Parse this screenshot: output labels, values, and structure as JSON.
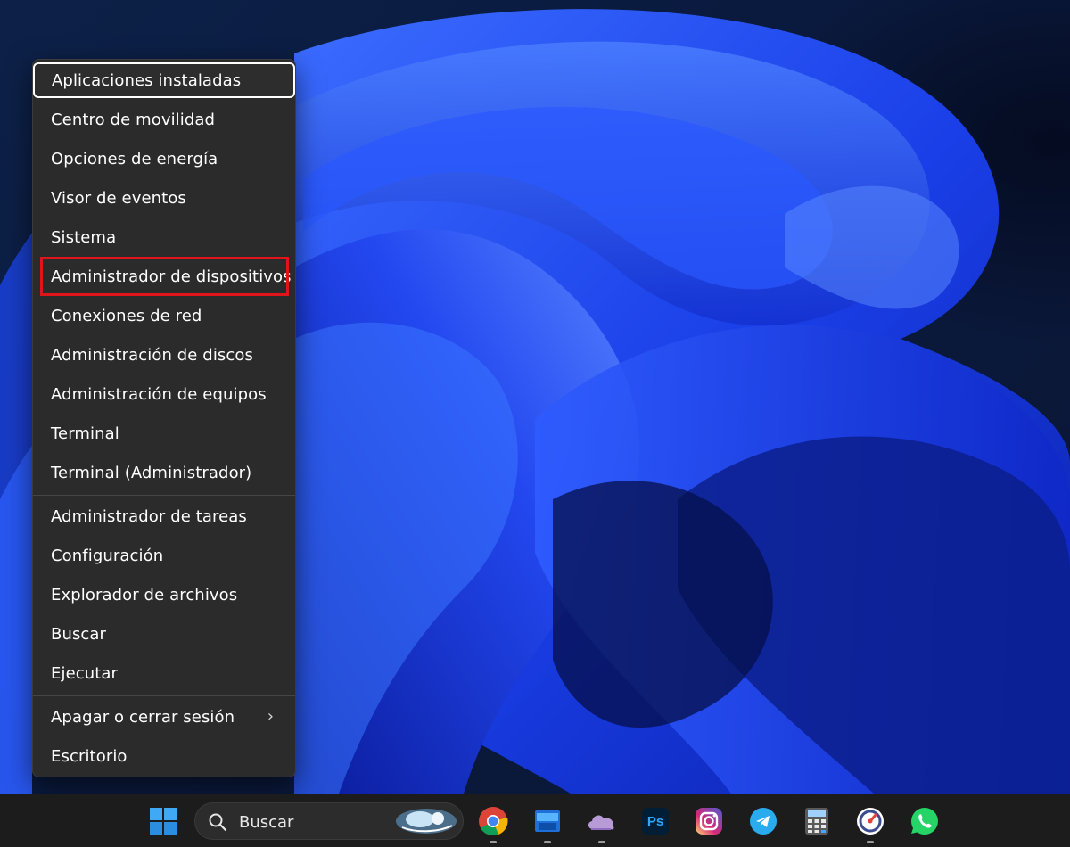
{
  "menu": {
    "groups": [
      [
        {
          "label": "Aplicaciones instaladas",
          "state": "focused"
        },
        {
          "label": "Centro de movilidad"
        },
        {
          "label": "Opciones de energía"
        },
        {
          "label": "Visor de eventos"
        },
        {
          "label": "Sistema"
        },
        {
          "label": "Administrador de dispositivos",
          "state": "highlighted"
        },
        {
          "label": "Conexiones de red"
        },
        {
          "label": "Administración de discos"
        },
        {
          "label": "Administración de equipos"
        },
        {
          "label": "Terminal"
        },
        {
          "label": "Terminal (Administrador)"
        }
      ],
      [
        {
          "label": "Administrador de tareas"
        },
        {
          "label": "Configuración"
        },
        {
          "label": "Explorador de archivos"
        },
        {
          "label": "Buscar"
        },
        {
          "label": "Ejecutar"
        }
      ],
      [
        {
          "label": "Apagar o cerrar sesión",
          "submenu": true
        },
        {
          "label": "Escritorio"
        }
      ]
    ],
    "submenu_glyph": "›",
    "highlight_color": "#e0151b"
  },
  "taskbar": {
    "search_placeholder": "Buscar",
    "apps": [
      {
        "name": "start-icon"
      },
      {
        "name": "search-icon"
      },
      {
        "name": "chrome-icon",
        "running": true
      },
      {
        "name": "file-explorer-icon",
        "running": true
      },
      {
        "name": "onedrive-icon",
        "running": true
      },
      {
        "name": "photoshop-icon",
        "label": "Ps"
      },
      {
        "name": "instagram-icon"
      },
      {
        "name": "telegram-icon"
      },
      {
        "name": "calculator-icon"
      },
      {
        "name": "speedtest-icon",
        "running": true
      },
      {
        "name": "whatsapp-icon"
      }
    ]
  }
}
